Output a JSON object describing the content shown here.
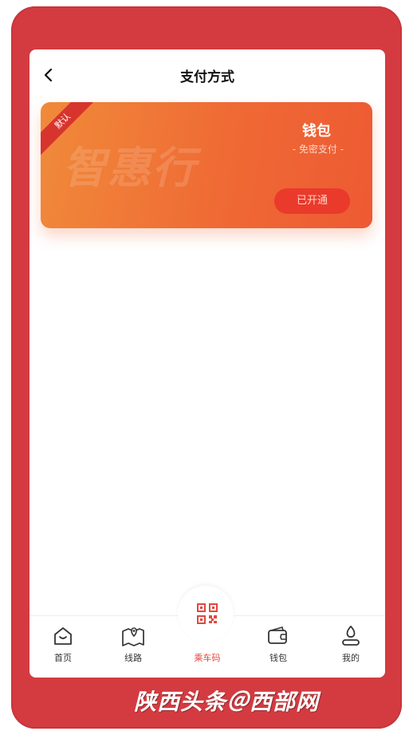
{
  "header": {
    "title": "支付方式"
  },
  "card": {
    "ribbon": "默认",
    "watermark": "智惠行",
    "title": "钱包",
    "subtitle": "- 免密支付 -",
    "status": "已开通"
  },
  "tabs": [
    {
      "label": "首页",
      "icon": "home-icon"
    },
    {
      "label": "线路",
      "icon": "map-icon"
    },
    {
      "label": "乘车码",
      "icon": "qr-code-icon"
    },
    {
      "label": "钱包",
      "icon": "wallet-icon"
    },
    {
      "label": "我的",
      "icon": "user-icon"
    }
  ],
  "colors": {
    "frame": "#d33b41",
    "card_start": "#f08a3a",
    "card_end": "#ee5a33",
    "accent": "#e0483f"
  },
  "footer": {
    "brand": "陕西头条＠西部网"
  }
}
